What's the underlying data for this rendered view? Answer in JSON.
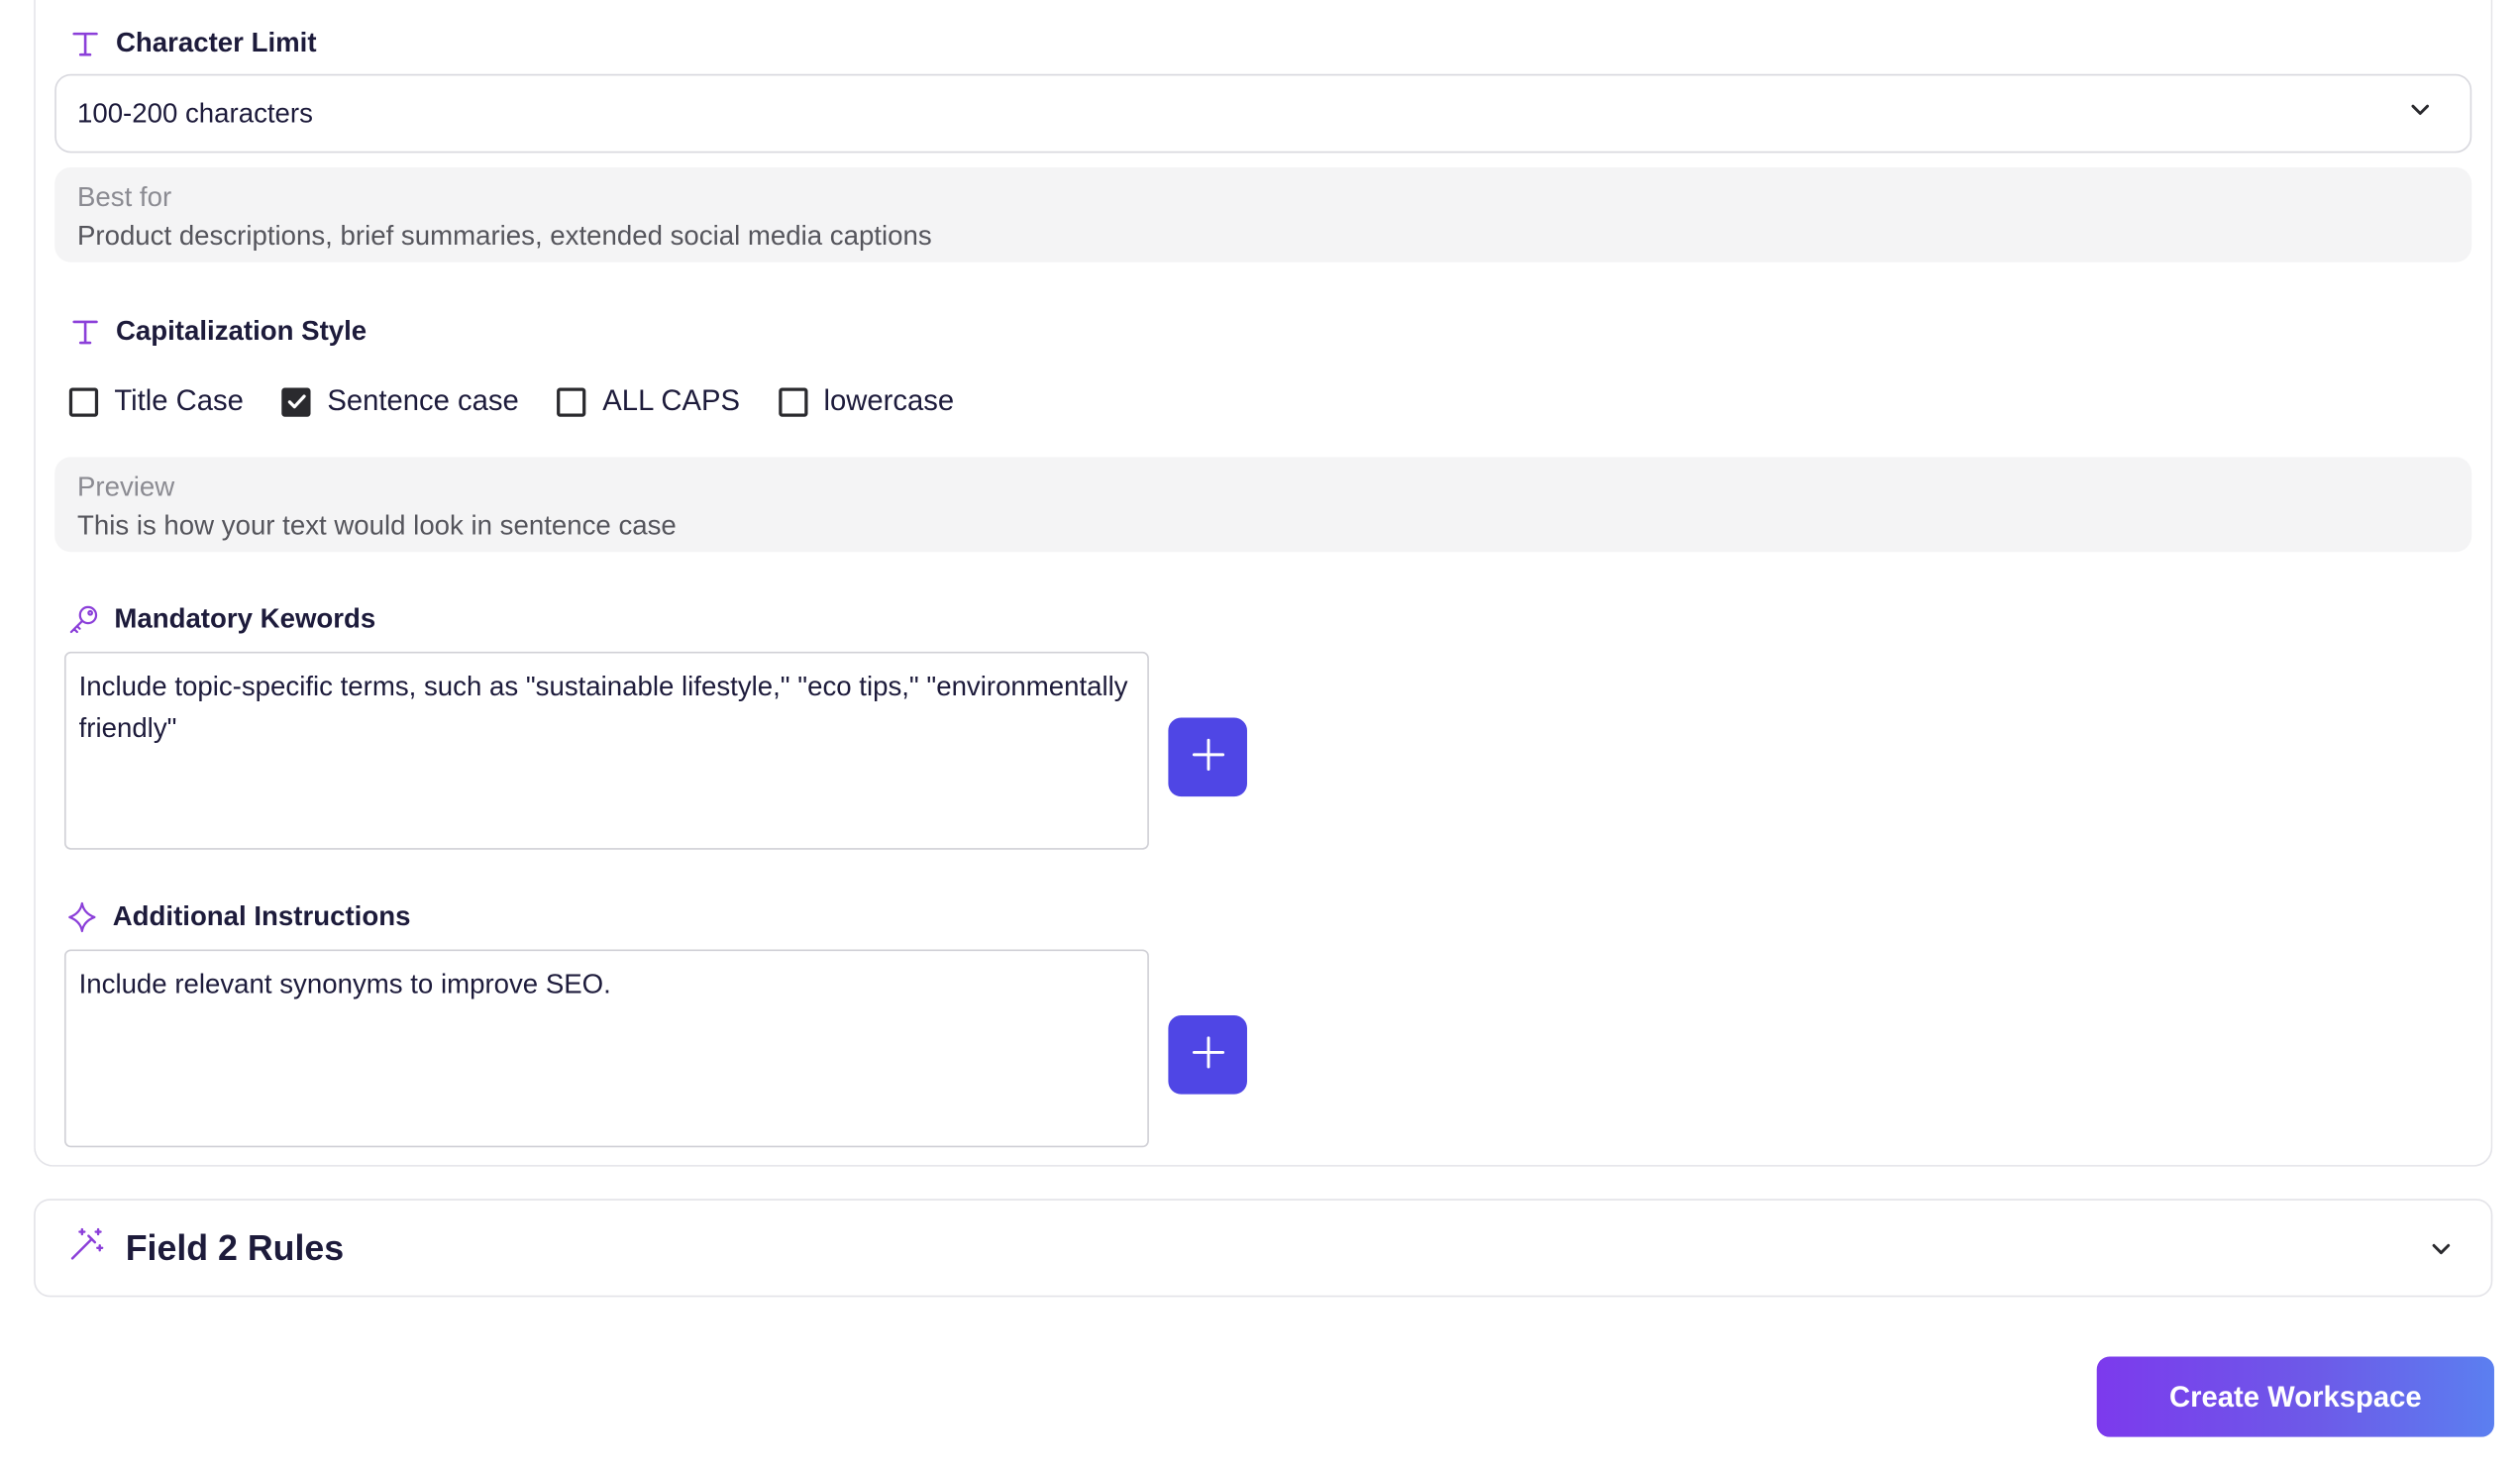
{
  "character_limit": {
    "label": "Character Limit",
    "selected": "100-200 characters",
    "info_label": "Best for",
    "info_text": "Product descriptions, brief summaries, extended social media captions"
  },
  "capitalization": {
    "label": "Capitalization Style",
    "options": [
      {
        "label": "Title Case",
        "checked": false
      },
      {
        "label": "Sentence case",
        "checked": true
      },
      {
        "label": "ALL CAPS",
        "checked": false
      },
      {
        "label": "lowercase",
        "checked": false
      }
    ],
    "preview_label": "Preview",
    "preview_text": "This is how your text would look in sentence case"
  },
  "keywords": {
    "label": "Mandatory Kewords",
    "value": "Include topic-specific terms, such as \"sustainable lifestyle,\" \"eco tips,\" \"environmentally friendly\""
  },
  "instructions": {
    "label": "Additional Instructions",
    "value": "Include relevant synonyms to improve SEO."
  },
  "field2": {
    "title": "Field 2 Rules"
  },
  "actions": {
    "create_label": "Create Workspace"
  },
  "colors": {
    "accent": "#4f46e5",
    "icon_purple": "#8b3fd9",
    "cta_start": "#7c3aed",
    "cta_end": "#5b7ff0"
  },
  "icons": {
    "character_limit": "type-icon",
    "capitalization": "type-icon",
    "keywords": "key-icon",
    "instructions": "sparkle-icon",
    "field2": "magic-wand-icon",
    "add": "plus-icon",
    "dropdown": "chevron-down-icon"
  }
}
